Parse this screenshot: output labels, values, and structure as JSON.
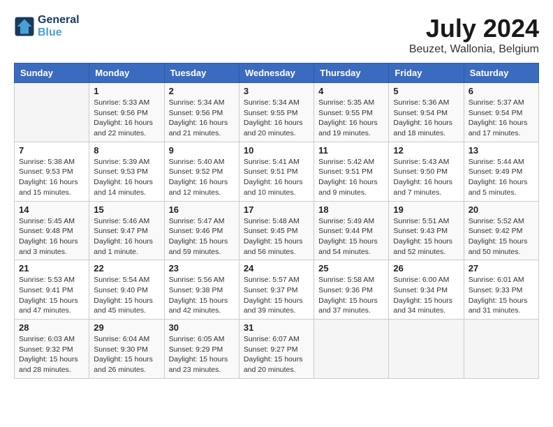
{
  "header": {
    "logo_line1": "General",
    "logo_line2": "Blue",
    "month": "July 2024",
    "location": "Beuzet, Wallonia, Belgium"
  },
  "days_of_week": [
    "Sunday",
    "Monday",
    "Tuesday",
    "Wednesday",
    "Thursday",
    "Friday",
    "Saturday"
  ],
  "weeks": [
    [
      {
        "day": "",
        "info": ""
      },
      {
        "day": "1",
        "info": "Sunrise: 5:33 AM\nSunset: 9:56 PM\nDaylight: 16 hours\nand 22 minutes."
      },
      {
        "day": "2",
        "info": "Sunrise: 5:34 AM\nSunset: 9:56 PM\nDaylight: 16 hours\nand 21 minutes."
      },
      {
        "day": "3",
        "info": "Sunrise: 5:34 AM\nSunset: 9:55 PM\nDaylight: 16 hours\nand 20 minutes."
      },
      {
        "day": "4",
        "info": "Sunrise: 5:35 AM\nSunset: 9:55 PM\nDaylight: 16 hours\nand 19 minutes."
      },
      {
        "day": "5",
        "info": "Sunrise: 5:36 AM\nSunset: 9:54 PM\nDaylight: 16 hours\nand 18 minutes."
      },
      {
        "day": "6",
        "info": "Sunrise: 5:37 AM\nSunset: 9:54 PM\nDaylight: 16 hours\nand 17 minutes."
      }
    ],
    [
      {
        "day": "7",
        "info": "Sunrise: 5:38 AM\nSunset: 9:53 PM\nDaylight: 16 hours\nand 15 minutes."
      },
      {
        "day": "8",
        "info": "Sunrise: 5:39 AM\nSunset: 9:53 PM\nDaylight: 16 hours\nand 14 minutes."
      },
      {
        "day": "9",
        "info": "Sunrise: 5:40 AM\nSunset: 9:52 PM\nDaylight: 16 hours\nand 12 minutes."
      },
      {
        "day": "10",
        "info": "Sunrise: 5:41 AM\nSunset: 9:51 PM\nDaylight: 16 hours\nand 10 minutes."
      },
      {
        "day": "11",
        "info": "Sunrise: 5:42 AM\nSunset: 9:51 PM\nDaylight: 16 hours\nand 9 minutes."
      },
      {
        "day": "12",
        "info": "Sunrise: 5:43 AM\nSunset: 9:50 PM\nDaylight: 16 hours\nand 7 minutes."
      },
      {
        "day": "13",
        "info": "Sunrise: 5:44 AM\nSunset: 9:49 PM\nDaylight: 16 hours\nand 5 minutes."
      }
    ],
    [
      {
        "day": "14",
        "info": "Sunrise: 5:45 AM\nSunset: 9:48 PM\nDaylight: 16 hours\nand 3 minutes."
      },
      {
        "day": "15",
        "info": "Sunrise: 5:46 AM\nSunset: 9:47 PM\nDaylight: 16 hours\nand 1 minute."
      },
      {
        "day": "16",
        "info": "Sunrise: 5:47 AM\nSunset: 9:46 PM\nDaylight: 15 hours\nand 59 minutes."
      },
      {
        "day": "17",
        "info": "Sunrise: 5:48 AM\nSunset: 9:45 PM\nDaylight: 15 hours\nand 56 minutes."
      },
      {
        "day": "18",
        "info": "Sunrise: 5:49 AM\nSunset: 9:44 PM\nDaylight: 15 hours\nand 54 minutes."
      },
      {
        "day": "19",
        "info": "Sunrise: 5:51 AM\nSunset: 9:43 PM\nDaylight: 15 hours\nand 52 minutes."
      },
      {
        "day": "20",
        "info": "Sunrise: 5:52 AM\nSunset: 9:42 PM\nDaylight: 15 hours\nand 50 minutes."
      }
    ],
    [
      {
        "day": "21",
        "info": "Sunrise: 5:53 AM\nSunset: 9:41 PM\nDaylight: 15 hours\nand 47 minutes."
      },
      {
        "day": "22",
        "info": "Sunrise: 5:54 AM\nSunset: 9:40 PM\nDaylight: 15 hours\nand 45 minutes."
      },
      {
        "day": "23",
        "info": "Sunrise: 5:56 AM\nSunset: 9:38 PM\nDaylight: 15 hours\nand 42 minutes."
      },
      {
        "day": "24",
        "info": "Sunrise: 5:57 AM\nSunset: 9:37 PM\nDaylight: 15 hours\nand 39 minutes."
      },
      {
        "day": "25",
        "info": "Sunrise: 5:58 AM\nSunset: 9:36 PM\nDaylight: 15 hours\nand 37 minutes."
      },
      {
        "day": "26",
        "info": "Sunrise: 6:00 AM\nSunset: 9:34 PM\nDaylight: 15 hours\nand 34 minutes."
      },
      {
        "day": "27",
        "info": "Sunrise: 6:01 AM\nSunset: 9:33 PM\nDaylight: 15 hours\nand 31 minutes."
      }
    ],
    [
      {
        "day": "28",
        "info": "Sunrise: 6:03 AM\nSunset: 9:32 PM\nDaylight: 15 hours\nand 28 minutes."
      },
      {
        "day": "29",
        "info": "Sunrise: 6:04 AM\nSunset: 9:30 PM\nDaylight: 15 hours\nand 26 minutes."
      },
      {
        "day": "30",
        "info": "Sunrise: 6:05 AM\nSunset: 9:29 PM\nDaylight: 15 hours\nand 23 minutes."
      },
      {
        "day": "31",
        "info": "Sunrise: 6:07 AM\nSunset: 9:27 PM\nDaylight: 15 hours\nand 20 minutes."
      },
      {
        "day": "",
        "info": ""
      },
      {
        "day": "",
        "info": ""
      },
      {
        "day": "",
        "info": ""
      }
    ]
  ]
}
